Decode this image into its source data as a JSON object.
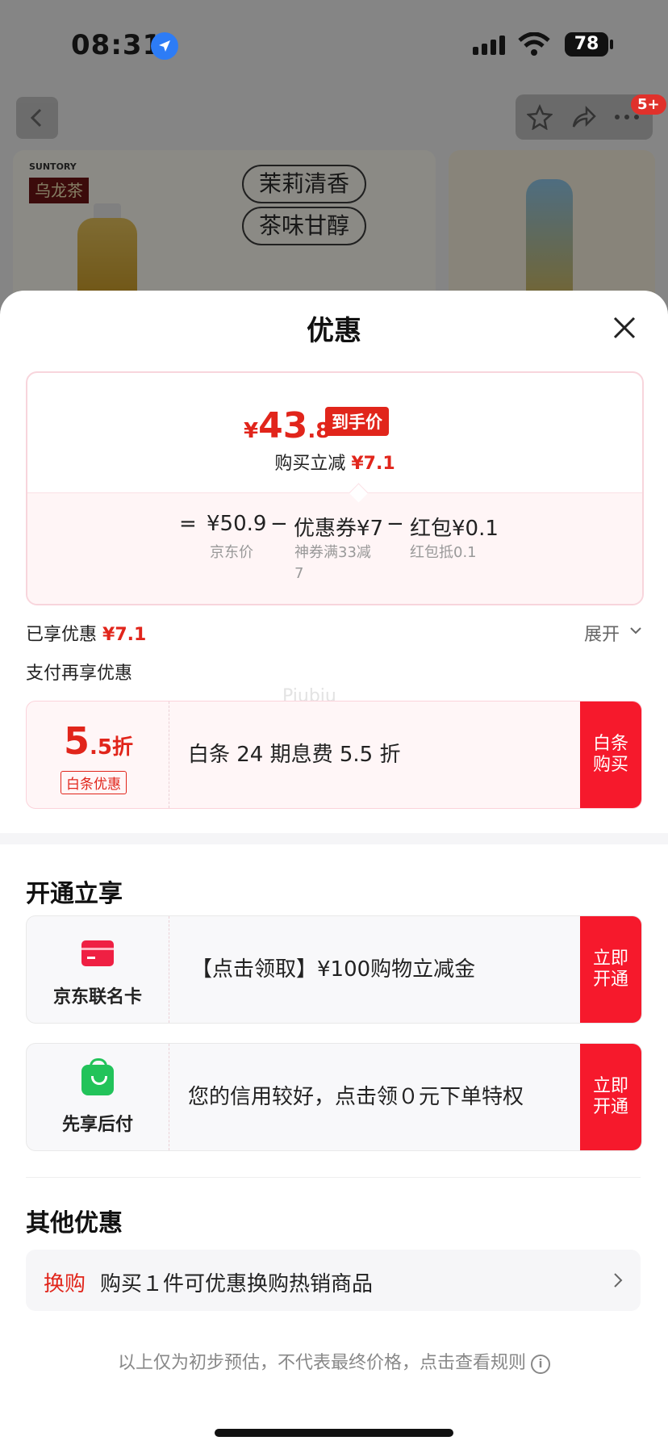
{
  "status_bar": {
    "time": "08:31",
    "battery": "78"
  },
  "header": {
    "badge": "5+"
  },
  "background_product": {
    "brand_en": "SUNTORY",
    "brand_cn": "乌龙茶",
    "pills": [
      "茉莉清香",
      "茶味甘醇"
    ]
  },
  "sheet": {
    "title": "优惠",
    "final_price": {
      "currency": "¥",
      "int": "43",
      "dec": ".8",
      "tag": "到手价"
    },
    "instant_discount": {
      "label": "购买立减",
      "value": "¥7.1"
    },
    "formula": {
      "eq": "=",
      "items": [
        {
          "value": "¥50.9",
          "label": "京东价"
        },
        {
          "value": "优惠券¥7",
          "label": "神券满33减\n7"
        },
        {
          "value": "红包¥0.1",
          "label": "红包抵0.1"
        }
      ],
      "minus": "−"
    },
    "enjoyed": {
      "label": "已享优惠",
      "value": "¥7.1"
    },
    "expand_label": "展开",
    "pay_title": "支付再享优惠",
    "watermark": "Piubiu",
    "baitiao": {
      "discount_int": "5",
      "discount_dec": ".5折",
      "tag": "白条优惠",
      "desc": "白条 24 期息费 5.5 折",
      "button": "白条\n购买"
    },
    "open_title": "开通立享",
    "open_offers": [
      {
        "name": "京东联名卡",
        "desc": "【点击领取】¥100购物立减金",
        "button": "立即\n开通",
        "icon": "credit-card-icon"
      },
      {
        "name": "先享后付",
        "desc": "您的信用较好，点击领０元下单特权",
        "button": "立即\n开通",
        "icon": "shopping-bag-icon"
      }
    ],
    "other_title": "其他优惠",
    "other_row": {
      "keyword": "换购",
      "text": "购买１件可优惠换购热销商品"
    },
    "footnote": "以上仅为初步预估，不代表最终价格，点击查看规则",
    "footnote_icon": "i"
  },
  "colors": {
    "accent_red": "#e1251b",
    "button_red": "#f6192c",
    "green": "#22c35a"
  }
}
